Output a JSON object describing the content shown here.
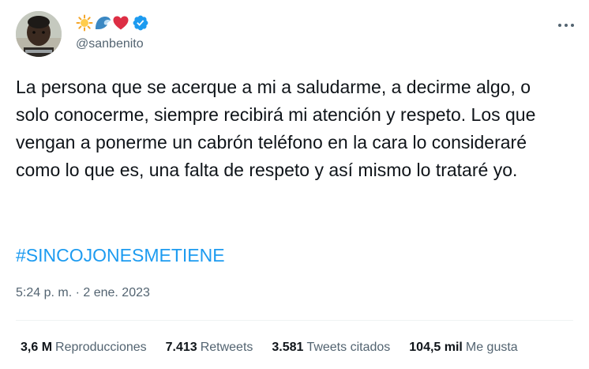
{
  "tweet": {
    "author": {
      "display_name_icons": [
        "sun-emoji",
        "wave-emoji",
        "red-heart-emoji"
      ],
      "verified_icon": "verified-badge-icon",
      "handle": "@sanbenito"
    },
    "more_icon": "more-options-icon",
    "text": "La persona que se acerque a mi a saludarme, a decirme algo, o solo conocerme, siempre recibirá mi atención y respeto. Los que vengan a ponerme un cabrón teléfono en la cara lo consideraré como lo que es, una falta de respeto y así mismo lo trataré yo.",
    "hashtag": "#SINCOJONESMETIENE",
    "timestamp": "5:24 p. m. · 2 ene. 2023",
    "stats": [
      {
        "value": "3,6 M",
        "label": "Reproducciones"
      },
      {
        "value": "7.413",
        "label": "Retweets"
      },
      {
        "value": "3.581",
        "label": "Tweets citados"
      },
      {
        "value": "104,5 mil",
        "label": "Me gusta"
      }
    ],
    "colors": {
      "text": "#0f1419",
      "secondary": "#536471",
      "link": "#1d9bf0",
      "divider": "#eff3f4"
    }
  }
}
